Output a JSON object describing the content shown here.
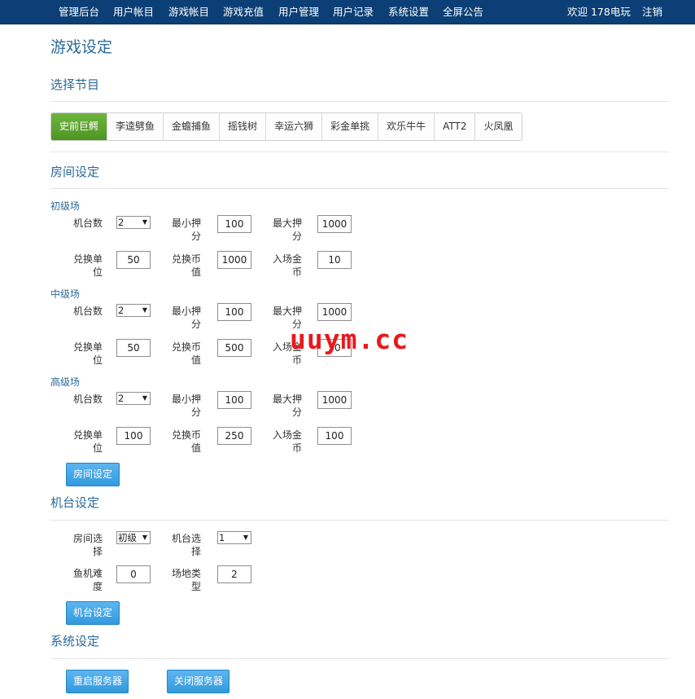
{
  "nav": {
    "items": [
      "管理后台",
      "用户帐目",
      "游戏帐目",
      "游戏充值",
      "用户管理",
      "用户记录",
      "系统设置",
      "全屏公告"
    ],
    "welcome": "欢迎 178电玩",
    "logout": "注销"
  },
  "page_title": "游戏设定",
  "section_program": "选择节目",
  "tabs": [
    "史前巨鳄",
    "李逵劈鱼",
    "金蟾捕鱼",
    "摇钱树",
    "幸运六狮",
    "彩金单挑",
    "欢乐牛牛",
    "ATT2",
    "火凤凰"
  ],
  "active_tab": 0,
  "section_room": "房间设定",
  "room_labels": {
    "machines": [
      "机台",
      "数"
    ],
    "min_bet": [
      "最小押",
      "分"
    ],
    "max_bet": [
      "最大押",
      "分"
    ],
    "exchange_unit": [
      "兑换单",
      "位"
    ],
    "exchange_value": [
      "兑换币",
      "值"
    ],
    "entry_coin": [
      "入场金",
      "币"
    ]
  },
  "rooms": [
    {
      "name": "初级场",
      "machines": "2",
      "min_bet": "100",
      "max_bet": "1000",
      "exchange_unit": "50",
      "exchange_value": "1000",
      "entry_coin": "10"
    },
    {
      "name": "中级场",
      "machines": "2",
      "min_bet": "100",
      "max_bet": "1000",
      "exchange_unit": "50",
      "exchange_value": "500",
      "entry_coin": "50"
    },
    {
      "name": "高级场",
      "machines": "2",
      "min_bet": "100",
      "max_bet": "1000",
      "exchange_unit": "100",
      "exchange_value": "250",
      "entry_coin": "100"
    }
  ],
  "room_button": "房间设定",
  "section_machine": "机台设定",
  "machine_labels": {
    "room_select": [
      "房间选",
      "择"
    ],
    "machine_select": [
      "机台选",
      "择"
    ],
    "difficulty": [
      "鱼机难",
      "度"
    ],
    "venue_type": [
      "场地类",
      "型"
    ]
  },
  "machine": {
    "room_select": "初级",
    "machine_select": "1",
    "difficulty": "0",
    "venue_type": "2"
  },
  "machine_button": "机台设定",
  "section_system": "系统设定",
  "restart_button": "重启服务器",
  "shutdown_button": "关闭服务器",
  "watermark": "uuym.cc",
  "colors": {
    "navbar": "#0b3f75",
    "heading": "#2b6a9a",
    "active_tab": "#5ba32f",
    "button": "#3ea3e6",
    "watermark": "#e8191e"
  }
}
